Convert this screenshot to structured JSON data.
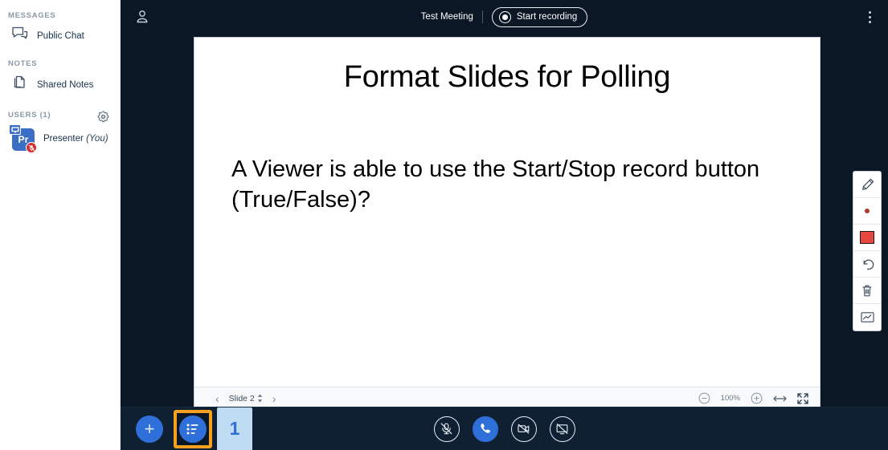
{
  "sidebar": {
    "sections": [
      {
        "title": "MESSAGES",
        "items": [
          {
            "label": "Public Chat",
            "icon": "chat-bubble-icon"
          }
        ]
      },
      {
        "title": "NOTES",
        "items": [
          {
            "label": "Shared Notes",
            "icon": "notes-pages-icon"
          }
        ]
      }
    ],
    "users_section": {
      "title": "USERS (1)",
      "settings_icon": "gear-icon",
      "users": [
        {
          "initials": "Pr",
          "name": "Presenter",
          "suffix": "(You)",
          "presenter_icon": "presentation-screen-icon",
          "mic_icon": "mic-muted-icon",
          "avatar_color": "#3b6ec4",
          "mic_badge_color": "#d32f2f"
        }
      ]
    }
  },
  "topbar": {
    "user_icon": "user-icon",
    "meeting_title": "Test Meeting",
    "record_button": {
      "label": "Start recording",
      "icon": "record-circle-icon"
    },
    "options_icon": "kebab-menu-icon"
  },
  "slide": {
    "title": "Format Slides for Polling",
    "body": "A Viewer is able to use the Start/Stop record button (True/False)?"
  },
  "board_bar": {
    "prev_icon": "chevron-left-icon",
    "next_icon": "chevron-right-icon",
    "slide_label": "Slide 2",
    "spinner_icon": "up-down-arrows-icon",
    "zoom_out_icon": "minus-circle-icon",
    "zoom_level": "100%",
    "zoom_in_icon": "plus-circle-icon",
    "fit_width_icon": "fit-to-width-icon",
    "fullscreen_icon": "fullscreen-icon"
  },
  "tools": [
    {
      "name": "pencil-icon",
      "label": "Pencil"
    },
    {
      "name": "thickness-dot-icon",
      "label": "Thickness"
    },
    {
      "name": "color-swatch-icon",
      "label": "Color",
      "color": "#e8473f"
    },
    {
      "name": "undo-icon",
      "label": "Undo"
    },
    {
      "name": "trash-icon",
      "label": "Delete"
    },
    {
      "name": "multi-user-whiteboard-icon",
      "label": "Multi-user whiteboard"
    }
  ],
  "bottom_bar": {
    "actions_button": {
      "icon": "plus-icon",
      "color": "#2f6fd9"
    },
    "polling_button": {
      "icon": "poll-list-icon",
      "highlighted": true,
      "highlight_color": "#f5a01f"
    },
    "step_badge": {
      "number": "1",
      "bg": "#bfdcf2",
      "fg": "#2f6fd9"
    },
    "media": [
      {
        "name": "mic-muted-button",
        "icon": "mic-muted-icon",
        "filled": false
      },
      {
        "name": "leave-audio-button",
        "icon": "phone-icon",
        "filled": true
      },
      {
        "name": "camera-off-button",
        "icon": "camera-off-icon",
        "filled": false
      },
      {
        "name": "share-screen-button",
        "icon": "screen-share-icon",
        "filled": false
      }
    ]
  }
}
